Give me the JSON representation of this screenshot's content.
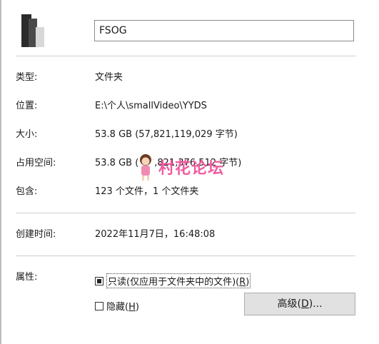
{
  "header": {
    "folder_name": "FSOG"
  },
  "properties": [
    {
      "label": "类型:",
      "value": "文件夹"
    },
    {
      "label": "位置:",
      "value": "E:\\个人\\smallVideo\\YYDS"
    },
    {
      "label": "大小:",
      "value": "53.8 GB (57,821,119,029 字节)"
    },
    {
      "label": "占用空间:",
      "value": "53.8 GB (",
      "value_tail": ",821,376,512 字节)"
    },
    {
      "label": "包含:",
      "value": "123 个文件，1 个文件夹"
    }
  ],
  "created": {
    "label": "创建时间:",
    "value": "2022年11月7日，16:48:08"
  },
  "attributes": {
    "label": "属性:",
    "readonly": {
      "text": "只读(仅应用于文件夹中的文件)(",
      "key": "R",
      "close": ")"
    },
    "hidden": {
      "text": "隐藏(",
      "key": "H",
      "close": ")"
    },
    "advanced": {
      "text": "高级(",
      "key": "D",
      "close": ")..."
    }
  },
  "watermark": {
    "text": "村花论坛"
  }
}
